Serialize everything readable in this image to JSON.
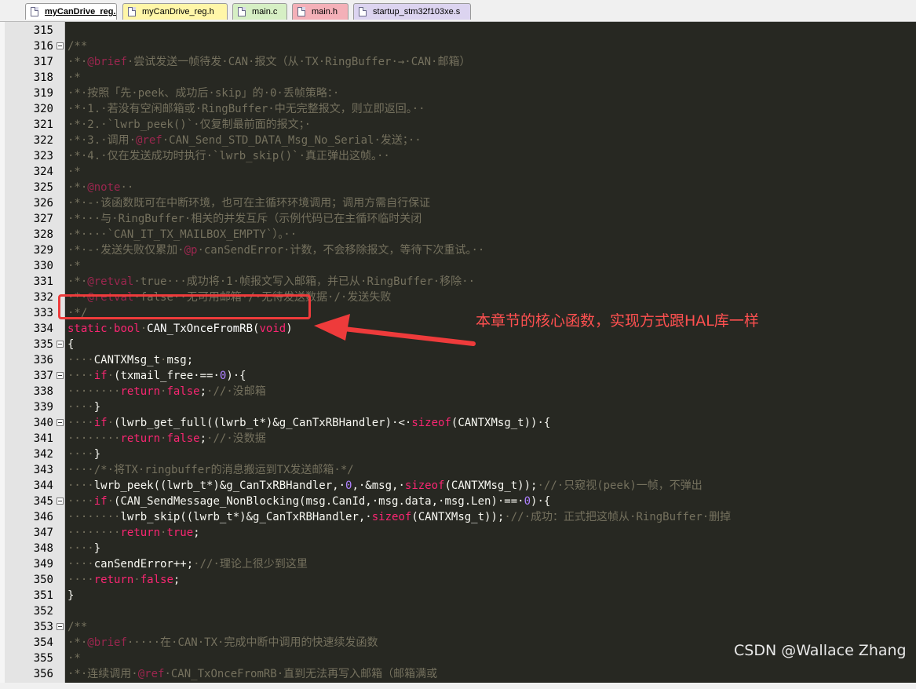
{
  "tabs": [
    {
      "label": "myCanDrive_reg.c",
      "color": "#ffffff",
      "active": true
    },
    {
      "label": "myCanDrive_reg.h",
      "color": "#fff6a8",
      "active": false
    },
    {
      "label": "main.c",
      "color": "#d6efc4",
      "active": false
    },
    {
      "label": "main.h",
      "color": "#f4b0b8",
      "active": false
    },
    {
      "label": "startup_stm32f103xe.s",
      "color": "#dcd4f0",
      "active": false
    }
  ],
  "lines": [
    {
      "n": "315",
      "fold": false,
      "segs": []
    },
    {
      "n": "316",
      "fold": true,
      "segs": [
        {
          "c": "c",
          "t": "/**"
        }
      ]
    },
    {
      "n": "317",
      "fold": false,
      "segs": [
        {
          "c": "c",
          "t": "·*·"
        },
        {
          "c": "tg",
          "t": "@brief"
        },
        {
          "c": "c",
          "t": "·尝试发送一帧待发·CAN·报文（从·TX·RingBuffer·→·CAN·邮箱）"
        }
      ]
    },
    {
      "n": "318",
      "fold": false,
      "segs": [
        {
          "c": "c",
          "t": "·*"
        }
      ]
    },
    {
      "n": "319",
      "fold": false,
      "segs": [
        {
          "c": "c",
          "t": "·*·按照「先·peek、成功后·skip」的·0·丢帧策略：·"
        }
      ]
    },
    {
      "n": "320",
      "fold": false,
      "segs": [
        {
          "c": "c",
          "t": "·*·1.·若没有空闲邮箱或·RingBuffer·中无完整报文，则立即返回。··"
        }
      ]
    },
    {
      "n": "321",
      "fold": false,
      "segs": [
        {
          "c": "c",
          "t": "·*·2.·`lwrb_peek()`·仅复制最前面的报文；·"
        }
      ]
    },
    {
      "n": "322",
      "fold": false,
      "segs": [
        {
          "c": "c",
          "t": "·*·3.·调用·"
        },
        {
          "c": "tg",
          "t": "@ref"
        },
        {
          "c": "c",
          "t": "·CAN_Send_STD_DATA_Msg_No_Serial·发送；··"
        }
      ]
    },
    {
      "n": "323",
      "fold": false,
      "segs": [
        {
          "c": "c",
          "t": "·*·4.·仅在发送成功时执行·`lwrb_skip()`·真正弹出这帧。··"
        }
      ]
    },
    {
      "n": "324",
      "fold": false,
      "segs": [
        {
          "c": "c",
          "t": "·*"
        }
      ]
    },
    {
      "n": "325",
      "fold": false,
      "segs": [
        {
          "c": "c",
          "t": "·*·"
        },
        {
          "c": "tg",
          "t": "@note"
        },
        {
          "c": "c",
          "t": "··"
        }
      ]
    },
    {
      "n": "326",
      "fold": false,
      "segs": [
        {
          "c": "c",
          "t": "·*·-·该函数既可在中断环境，也可在主循环环境调用；调用方需自行保证"
        }
      ]
    },
    {
      "n": "327",
      "fold": false,
      "segs": [
        {
          "c": "c",
          "t": "·*···与·RingBuffer·相关的并发互斥（示例代码已在主循环临时关闭"
        }
      ]
    },
    {
      "n": "328",
      "fold": false,
      "segs": [
        {
          "c": "c",
          "t": "·*····`CAN_IT_TX_MAILBOX_EMPTY`）。··"
        }
      ]
    },
    {
      "n": "329",
      "fold": false,
      "segs": [
        {
          "c": "c",
          "t": "·*·-·发送失败仅累加·"
        },
        {
          "c": "tg",
          "t": "@p"
        },
        {
          "c": "c",
          "t": "·canSendError·计数，不会移除报文，等待下次重试。··"
        }
      ]
    },
    {
      "n": "330",
      "fold": false,
      "segs": [
        {
          "c": "c",
          "t": "·*"
        }
      ]
    },
    {
      "n": "331",
      "fold": false,
      "segs": [
        {
          "c": "c",
          "t": "·*·"
        },
        {
          "c": "tg",
          "t": "@retval"
        },
        {
          "c": "c",
          "t": "·true···成功将·1·帧报文写入邮箱，并已从·RingBuffer·移除··"
        }
      ]
    },
    {
      "n": "332",
      "fold": false,
      "segs": [
        {
          "c": "c",
          "t": "·*·"
        },
        {
          "c": "tg",
          "t": "@retval"
        },
        {
          "c": "c",
          "t": "·false··无可用邮箱·/·无待发送数据·/·发送失败"
        }
      ]
    },
    {
      "n": "333",
      "fold": false,
      "segs": [
        {
          "c": "c",
          "t": "·*/"
        }
      ]
    },
    {
      "n": "334",
      "fold": false,
      "segs": [
        {
          "c": "k",
          "t": "static"
        },
        {
          "c": "c",
          "t": "·"
        },
        {
          "c": "k",
          "t": "bool"
        },
        {
          "c": "c",
          "t": "·"
        },
        {
          "c": "f",
          "t": "CAN_TxOnceFromRB"
        },
        {
          "c": "p",
          "t": "("
        },
        {
          "c": "k",
          "t": "void"
        },
        {
          "c": "p",
          "t": ")"
        }
      ]
    },
    {
      "n": "335",
      "fold": true,
      "segs": [
        {
          "c": "p",
          "t": "{"
        }
      ]
    },
    {
      "n": "336",
      "fold": false,
      "segs": [
        {
          "c": "c",
          "t": "····"
        },
        {
          "c": "p",
          "t": "CANTXMsg_t"
        },
        {
          "c": "c",
          "t": "·"
        },
        {
          "c": "p",
          "t": "msg;"
        }
      ]
    },
    {
      "n": "337",
      "fold": true,
      "segs": [
        {
          "c": "c",
          "t": "····"
        },
        {
          "c": "k",
          "t": "if"
        },
        {
          "c": "c",
          "t": "·"
        },
        {
          "c": "p",
          "t": "(txmail_free·==·"
        },
        {
          "c": "n",
          "t": "0"
        },
        {
          "c": "p",
          "t": ")·{"
        }
      ]
    },
    {
      "n": "338",
      "fold": false,
      "segs": [
        {
          "c": "c",
          "t": "········"
        },
        {
          "c": "k",
          "t": "return"
        },
        {
          "c": "c",
          "t": "·"
        },
        {
          "c": "k",
          "t": "false"
        },
        {
          "c": "p",
          "t": ";"
        },
        {
          "c": "c",
          "t": "·//·没邮箱"
        }
      ]
    },
    {
      "n": "339",
      "fold": false,
      "segs": [
        {
          "c": "c",
          "t": "····"
        },
        {
          "c": "p",
          "t": "}"
        }
      ]
    },
    {
      "n": "340",
      "fold": true,
      "segs": [
        {
          "c": "c",
          "t": "····"
        },
        {
          "c": "k",
          "t": "if"
        },
        {
          "c": "c",
          "t": "·"
        },
        {
          "c": "p",
          "t": "(lwrb_get_full((lwrb_t*)&g_CanTxRBHandler)·<·"
        },
        {
          "c": "k",
          "t": "sizeof"
        },
        {
          "c": "p",
          "t": "(CANTXMsg_t))·{"
        }
      ]
    },
    {
      "n": "341",
      "fold": false,
      "segs": [
        {
          "c": "c",
          "t": "········"
        },
        {
          "c": "k",
          "t": "return"
        },
        {
          "c": "c",
          "t": "·"
        },
        {
          "c": "k",
          "t": "false"
        },
        {
          "c": "p",
          "t": ";"
        },
        {
          "c": "c",
          "t": "·//·没数据"
        }
      ]
    },
    {
      "n": "342",
      "fold": false,
      "segs": [
        {
          "c": "c",
          "t": "····"
        },
        {
          "c": "p",
          "t": "}"
        }
      ]
    },
    {
      "n": "343",
      "fold": false,
      "segs": [
        {
          "c": "c",
          "t": "····/*·将TX·ringbuffer的消息搬运到TX发送邮箱·*/"
        }
      ]
    },
    {
      "n": "344",
      "fold": false,
      "segs": [
        {
          "c": "c",
          "t": "····"
        },
        {
          "c": "p",
          "t": "lwrb_peek((lwrb_t*)&g_CanTxRBHandler,·"
        },
        {
          "c": "n",
          "t": "0"
        },
        {
          "c": "p",
          "t": ",·&msg,·"
        },
        {
          "c": "k",
          "t": "sizeof"
        },
        {
          "c": "p",
          "t": "(CANTXMsg_t));"
        },
        {
          "c": "c",
          "t": "·//·只窥视(peek)一帧，不弹出"
        }
      ]
    },
    {
      "n": "345",
      "fold": true,
      "segs": [
        {
          "c": "c",
          "t": "····"
        },
        {
          "c": "k",
          "t": "if"
        },
        {
          "c": "c",
          "t": "·"
        },
        {
          "c": "p",
          "t": "(CAN_SendMessage_NonBlocking(msg.CanId,·msg.data,·msg.Len)·==·"
        },
        {
          "c": "n",
          "t": "0"
        },
        {
          "c": "p",
          "t": ")·{"
        }
      ]
    },
    {
      "n": "346",
      "fold": false,
      "segs": [
        {
          "c": "c",
          "t": "········"
        },
        {
          "c": "p",
          "t": "lwrb_skip((lwrb_t*)&g_CanTxRBHandler,·"
        },
        {
          "c": "k",
          "t": "sizeof"
        },
        {
          "c": "p",
          "t": "(CANTXMsg_t));"
        },
        {
          "c": "c",
          "t": "·//·成功：正式把这帧从·RingBuffer·删掉"
        }
      ]
    },
    {
      "n": "347",
      "fold": false,
      "segs": [
        {
          "c": "c",
          "t": "········"
        },
        {
          "c": "k",
          "t": "return"
        },
        {
          "c": "c",
          "t": "·"
        },
        {
          "c": "k",
          "t": "true"
        },
        {
          "c": "p",
          "t": ";"
        }
      ]
    },
    {
      "n": "348",
      "fold": false,
      "segs": [
        {
          "c": "c",
          "t": "····"
        },
        {
          "c": "p",
          "t": "}"
        }
      ]
    },
    {
      "n": "349",
      "fold": false,
      "segs": [
        {
          "c": "c",
          "t": "····"
        },
        {
          "c": "p",
          "t": "canSendError++;"
        },
        {
          "c": "c",
          "t": "·//·理论上很少到这里"
        }
      ]
    },
    {
      "n": "350",
      "fold": false,
      "segs": [
        {
          "c": "c",
          "t": "····"
        },
        {
          "c": "k",
          "t": "return"
        },
        {
          "c": "c",
          "t": "·"
        },
        {
          "c": "k",
          "t": "false"
        },
        {
          "c": "p",
          "t": ";"
        }
      ]
    },
    {
      "n": "351",
      "fold": false,
      "segs": [
        {
          "c": "p",
          "t": "}"
        }
      ]
    },
    {
      "n": "352",
      "fold": false,
      "segs": []
    },
    {
      "n": "353",
      "fold": true,
      "segs": [
        {
          "c": "c",
          "t": "/**"
        }
      ]
    },
    {
      "n": "354",
      "fold": false,
      "segs": [
        {
          "c": "c",
          "t": "·*·"
        },
        {
          "c": "tg",
          "t": "@brief"
        },
        {
          "c": "c",
          "t": "·····在·CAN·TX·完成中断中调用的快速续发函数"
        }
      ]
    },
    {
      "n": "355",
      "fold": false,
      "segs": [
        {
          "c": "c",
          "t": "·*"
        }
      ]
    },
    {
      "n": "356",
      "fold": false,
      "segs": [
        {
          "c": "c",
          "t": "·*·连续调用·"
        },
        {
          "c": "tg",
          "t": "@ref"
        },
        {
          "c": "c",
          "t": "·CAN_TxOnceFromRB·直到无法再写入邮箱（邮箱满或"
        }
      ]
    }
  ],
  "callout": "本章节的核心函数，实现方式跟HAL库一样",
  "watermark": "CSDN @Wallace Zhang",
  "colors": {
    "editor_bg": "#272822",
    "gutter_bg": "#e4e4e4",
    "comment": "#75715e",
    "keyword": "#f92672",
    "number": "#ae81ff",
    "plain": "#f8f8f2",
    "annotation_red": "#ee3b3b"
  }
}
